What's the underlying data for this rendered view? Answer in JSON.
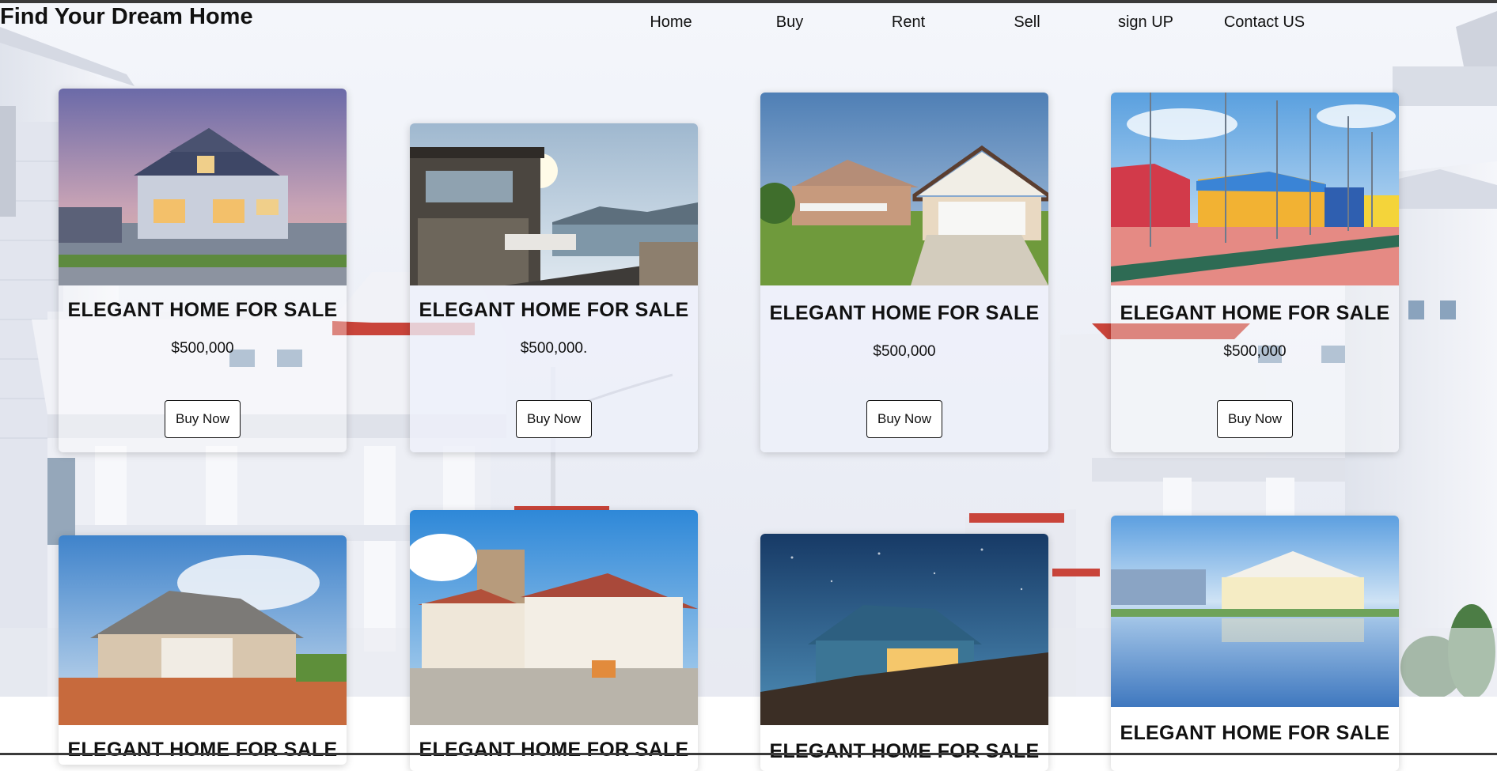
{
  "header": {
    "title": "Find Your Dream Home",
    "nav": [
      "Home",
      "Buy",
      "Rent",
      "Sell",
      "sign UP",
      "Contact US"
    ]
  },
  "listings": [
    {
      "title": "ELEGANT HOME FOR SALE",
      "price": "$500,000",
      "button": "Buy Now",
      "image": "house-dusk-photo"
    },
    {
      "title": "ELEGANT HOME FOR SALE",
      "price": "$500,000.",
      "button": "Buy Now",
      "image": "lakeside-house-photo"
    },
    {
      "title": "ELEGANT HOME FOR SALE",
      "price": "$500,000",
      "button": "Buy Now",
      "image": "ranch-house-photo"
    },
    {
      "title": "ELEGANT HOME FOR SALE",
      "price": "$500,000",
      "button": "Buy Now",
      "image": "colorful-houses-photo"
    },
    {
      "title": "ELEGANT HOME FOR SALE",
      "image": "farmhouse-photo"
    },
    {
      "title": "ELEGANT HOME FOR SALE",
      "image": "stone-villa-photo"
    },
    {
      "title": "ELEGANT HOME FOR SALE",
      "image": "night-house-photo"
    },
    {
      "title": "ELEGANT HOME FOR SALE",
      "image": "waterfront-houses-photo"
    }
  ],
  "colors": {
    "accent_border": "#111111",
    "roof_red": "#c9443a",
    "background_wall": "#eef0f6"
  }
}
